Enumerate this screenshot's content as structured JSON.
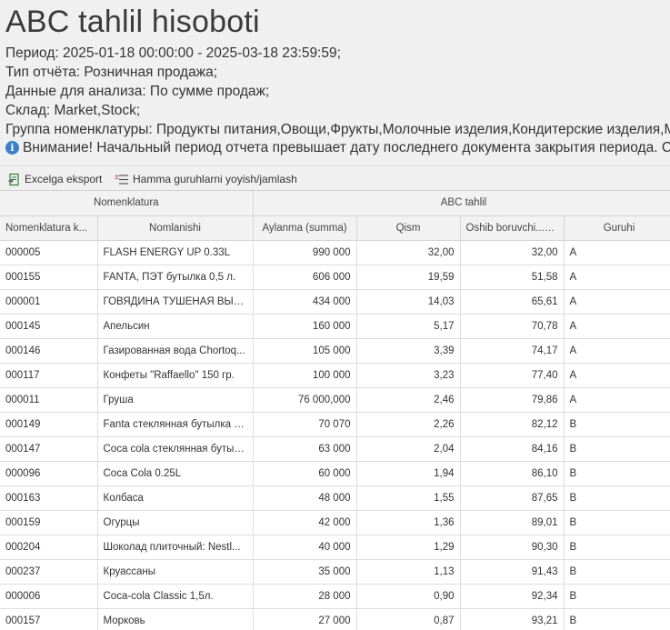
{
  "report": {
    "title": "ABC tahlil hisoboti",
    "lines": [
      "Период: 2025-01-18 00:00:00 - 2025-03-18 23:59:59;",
      "Тип отчёта: Розничная продажа;",
      "Данные для анализа: По сумме продаж;",
      "Склад: Market,Stock;",
      "Группа номенклатуры: Продукты питания,Овощи,Фрукты,Молочные изделия,Кондитерские изделия,М"
    ],
    "warning": "Внимание! Начальный период отчета превышает дату последнего документа закрытия периода. С",
    "warning_icon": "info-icon"
  },
  "toolbar": {
    "export_label": "Excelga eksport",
    "export_icon": "excel-export-icon",
    "group_label": "Hamma guruhlarni yoyish/jamlash",
    "group_icon": "expand-collapse-icon"
  },
  "table": {
    "group_headers": [
      "Nomenklatura",
      "ABC tahlil"
    ],
    "columns": [
      "Nomenklatura k...",
      "Nomlanishi",
      "Aylanma (summa)",
      "Qism",
      "Oshib boruvchi...",
      "Guruhi"
    ],
    "rows": [
      [
        "000005",
        "FLASH ENERGY UP 0.33L",
        "990 000",
        "32,00",
        "32,00",
        "A"
      ],
      [
        "000155",
        "FANTA, ПЭТ бутылка 0,5 л.",
        "606 000",
        "19,59",
        "51,58",
        "A"
      ],
      [
        "000001",
        "ГОВЯДИНА ТУШЕНАЯ ВЫСШ...",
        "434 000",
        "14,03",
        "65,61",
        "A"
      ],
      [
        "000145",
        "Апельсин",
        "160 000",
        "5,17",
        "70,78",
        "A"
      ],
      [
        "000146",
        "Газированная вода Chortoq...",
        "105 000",
        "3,39",
        "74,17",
        "A"
      ],
      [
        "000117",
        "Конфеты \"Raffaello\" 150 гр.",
        "100 000",
        "3,23",
        "77,40",
        "A"
      ],
      [
        "000011",
        "Груша",
        "76 000,000",
        "2,46",
        "79,86",
        "A"
      ],
      [
        "000149",
        "Fanta стеклянная бутылка 0,...",
        "70 070",
        "2,26",
        "82,12",
        "B"
      ],
      [
        "000147",
        "Coca cola стеклянная бутыл...",
        "63 000",
        "2,04",
        "84,16",
        "B"
      ],
      [
        "000096",
        "Coca Cola 0.25L",
        "60 000",
        "1,94",
        "86,10",
        "B"
      ],
      [
        "000163",
        "Колбаса",
        "48 000",
        "1,55",
        "87,65",
        "B"
      ],
      [
        "000159",
        "Огурцы",
        "42 000",
        "1,36",
        "89,01",
        "B"
      ],
      [
        "000204",
        "Шоколад плиточный: Nestl...",
        "40 000",
        "1,29",
        "90,30",
        "B"
      ],
      [
        "000237",
        "Круассаны",
        "35 000",
        "1,13",
        "91,43",
        "B"
      ],
      [
        "000006",
        "Coca-cola Classic 1,5л.",
        "28 000",
        "0,90",
        "92,34",
        "B"
      ],
      [
        "000157",
        "Морковь",
        "27 000",
        "0,87",
        "93,21",
        "B"
      ]
    ]
  }
}
